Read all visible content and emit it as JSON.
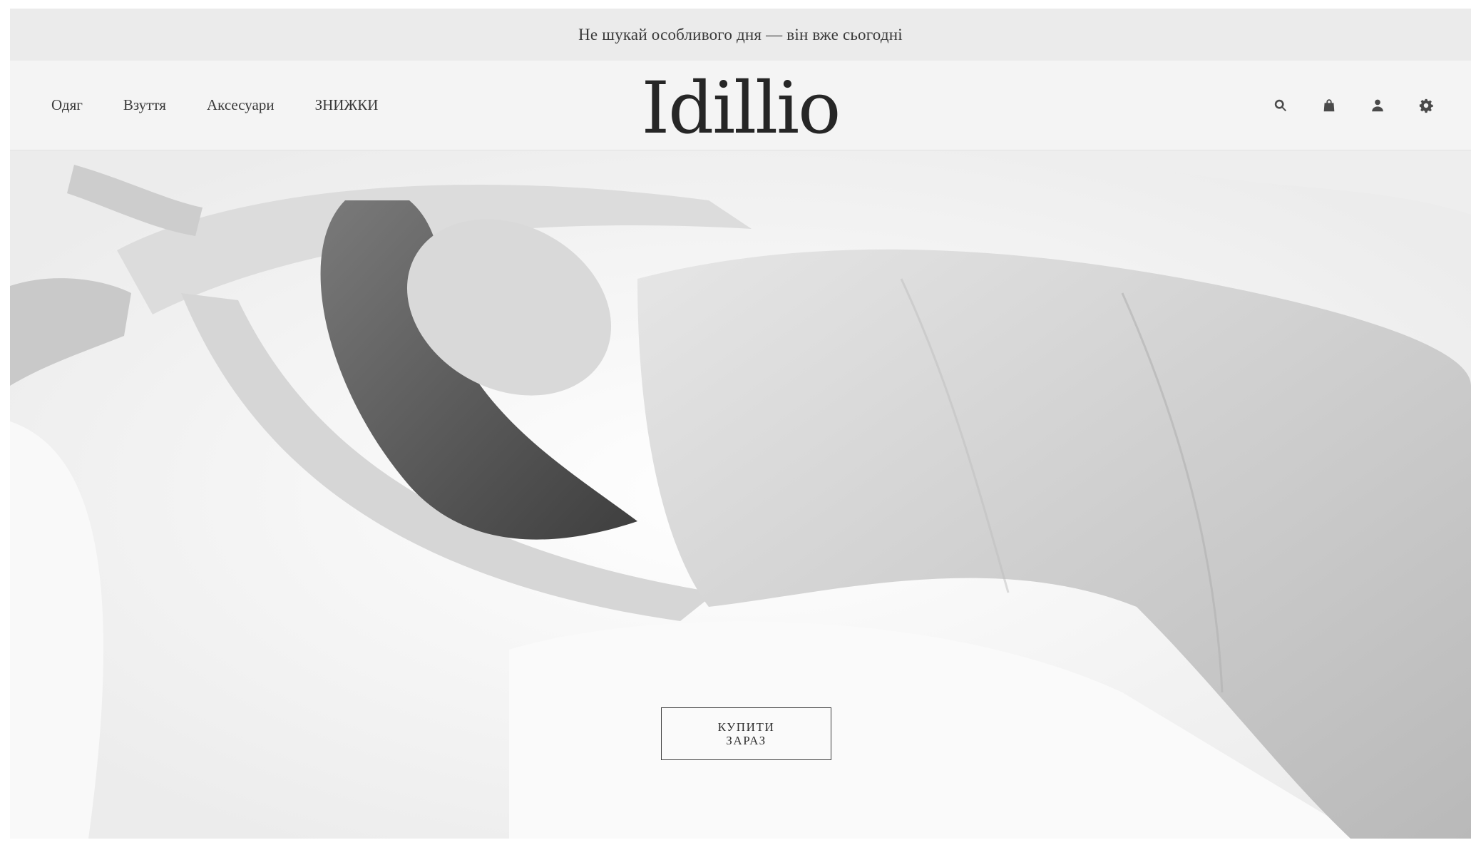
{
  "promo": {
    "text": "Не шукай особливого дня — він вже сьогодні"
  },
  "header": {
    "logo": "Idillio",
    "nav": [
      {
        "label": "Одяг"
      },
      {
        "label": "Взуття"
      },
      {
        "label": "Аксесуари"
      },
      {
        "label": "ЗНИЖКИ"
      }
    ],
    "icons": [
      "search-icon",
      "bag-icon",
      "user-icon",
      "gear-icon"
    ]
  },
  "hero": {
    "image": "black-and-white-photo-model-lying-on-white-fur",
    "cta_line1": "КУПИТИ",
    "cta_line2": "ЗАРАЗ"
  },
  "colors": {
    "promo_bg": "#ebebeb",
    "header_bg": "#f4f4f4",
    "text": "#2b2b2b"
  }
}
